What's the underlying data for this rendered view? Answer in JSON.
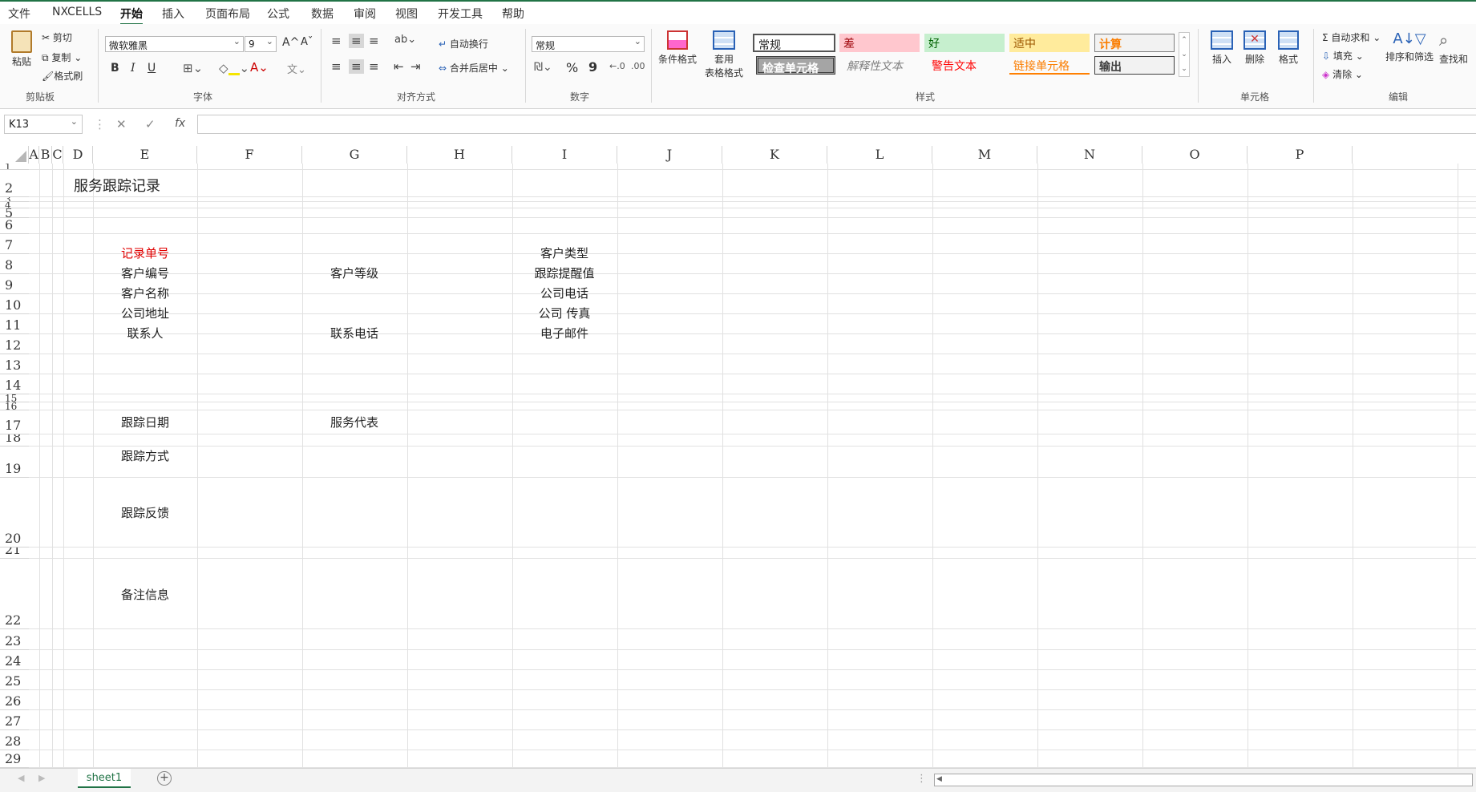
{
  "menu": [
    "文件",
    "NXCELLS",
    "开始",
    "插入",
    "页面布局",
    "公式",
    "数据",
    "审阅",
    "视图",
    "开发工具",
    "帮助"
  ],
  "ribbon": {
    "clipboard": {
      "paste": "粘贴",
      "cut": "剪切",
      "copy": "复制",
      "format_painter": "格式刷",
      "group": "剪贴板"
    },
    "font": {
      "name": "微软雅黑",
      "size": "9",
      "group": "字体",
      "grow": "A^",
      "shrink": "Aˇ",
      "bold": "B",
      "italic": "I",
      "underline": "U"
    },
    "alignment": {
      "wrap": "自动换行",
      "merge": "合并后居中",
      "group": "对齐方式"
    },
    "number": {
      "format": "常规",
      "percent": "%",
      "comma": "9",
      "group": "数字"
    },
    "styles": {
      "conditional": "条件格式",
      "table_line1": "套用",
      "table_line2": "表格格式",
      "group": "样式",
      "normal": "常规",
      "bad": "差",
      "good": "好",
      "neutral": "适中",
      "calc": "计算",
      "check": "检查单元格",
      "explain": "解释性文本",
      "warning": "警告文本",
      "linked": "链接单元格",
      "output": "输出"
    },
    "cells": {
      "insert": "插入",
      "delete": "删除",
      "format": "格式",
      "group": "单元格"
    },
    "editing": {
      "autosum": "自动求和",
      "fill": "填充",
      "clear": "清除",
      "sort": "排序和筛选",
      "find": "查找和",
      "group": "编辑"
    }
  },
  "formula_bar": {
    "cell_ref": "K13",
    "fx": "fx",
    "value": ""
  },
  "columns": [
    "A",
    "B",
    "C",
    "D",
    "E",
    "F",
    "G",
    "H",
    "I",
    "J",
    "K",
    "L",
    "M",
    "N",
    "O",
    "P"
  ],
  "rows": [
    "1",
    "2",
    "3",
    "4",
    "5",
    "6",
    "7",
    "8",
    "9",
    "10",
    "11",
    "12",
    "13",
    "14",
    "15",
    "16",
    "17",
    "18",
    "19",
    "20",
    "21",
    "22",
    "23",
    "24",
    "25",
    "26",
    "27",
    "28",
    "29"
  ],
  "sheet": {
    "title": "服务跟踪记录",
    "record_no": "记录单号",
    "customer_no": "客户编号",
    "customer_name": "客户名称",
    "company_addr": "公司地址",
    "contact": "联系人",
    "customer_level": "客户等级",
    "contact_phone": "联系电话",
    "customer_type": "客户类型",
    "reminder": "跟踪提醒值",
    "company_phone": "公司电话",
    "fax": "公司 传真",
    "email": "电子邮件",
    "track_date": "跟踪日期",
    "service_rep": "服务代表",
    "track_method": "跟踪方式",
    "feedback": "跟踪反馈",
    "remarks": "备注信息"
  },
  "tabs": {
    "sheet1": "sheet1"
  },
  "colors": {
    "accent": "#217346",
    "red_label": "#e00000"
  }
}
